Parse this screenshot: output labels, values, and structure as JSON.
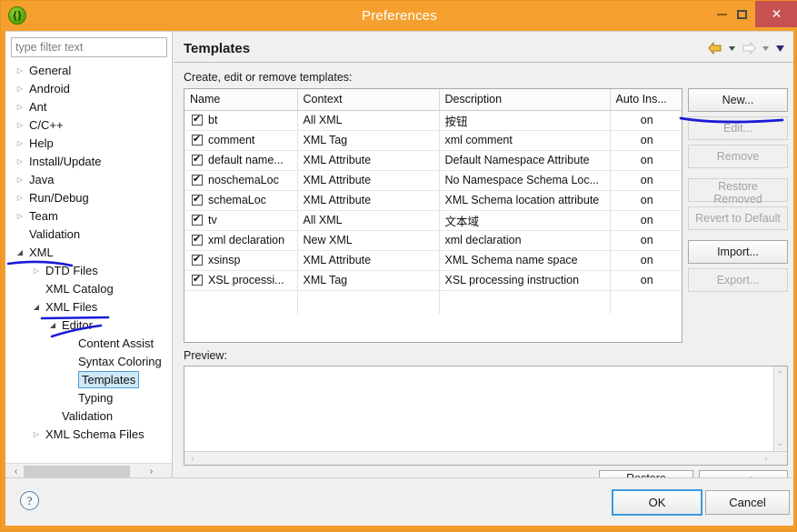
{
  "window": {
    "title": "Preferences",
    "icon": "braces-icon",
    "accent_color": "#f5a02e",
    "close_color": "#c75050",
    "controls": {
      "minimize": "minimize-icon",
      "maximize": "maximize-icon",
      "close": "close-icon"
    }
  },
  "sidebar": {
    "filter_placeholder": "type filter text",
    "filter_value": "",
    "scroll": {
      "left_arrow": "‹",
      "right_arrow": "›"
    },
    "items": [
      {
        "label": "General",
        "indent": 0,
        "arrow": "collapsed",
        "selected": false
      },
      {
        "label": "Android",
        "indent": 0,
        "arrow": "collapsed",
        "selected": false
      },
      {
        "label": "Ant",
        "indent": 0,
        "arrow": "collapsed",
        "selected": false
      },
      {
        "label": "C/C++",
        "indent": 0,
        "arrow": "collapsed",
        "selected": false
      },
      {
        "label": "Help",
        "indent": 0,
        "arrow": "collapsed",
        "selected": false
      },
      {
        "label": "Install/Update",
        "indent": 0,
        "arrow": "collapsed",
        "selected": false
      },
      {
        "label": "Java",
        "indent": 0,
        "arrow": "collapsed",
        "selected": false
      },
      {
        "label": "Run/Debug",
        "indent": 0,
        "arrow": "collapsed",
        "selected": false
      },
      {
        "label": "Team",
        "indent": 0,
        "arrow": "collapsed",
        "selected": false
      },
      {
        "label": "Validation",
        "indent": 0,
        "arrow": "none",
        "selected": false
      },
      {
        "label": "XML",
        "indent": 0,
        "arrow": "expanded",
        "selected": false
      },
      {
        "label": "DTD Files",
        "indent": 1,
        "arrow": "collapsed",
        "selected": false
      },
      {
        "label": "XML Catalog",
        "indent": 1,
        "arrow": "none",
        "selected": false
      },
      {
        "label": "XML Files",
        "indent": 1,
        "arrow": "expanded",
        "selected": false
      },
      {
        "label": "Editor",
        "indent": 2,
        "arrow": "expanded",
        "selected": false
      },
      {
        "label": "Content Assist",
        "indent": 3,
        "arrow": "none",
        "selected": false
      },
      {
        "label": "Syntax Coloring",
        "indent": 3,
        "arrow": "none",
        "selected": false
      },
      {
        "label": "Templates",
        "indent": 3,
        "arrow": "none",
        "selected": true
      },
      {
        "label": "Typing",
        "indent": 3,
        "arrow": "none",
        "selected": false
      },
      {
        "label": "Validation",
        "indent": 2,
        "arrow": "none",
        "selected": false
      },
      {
        "label": "XML Schema Files",
        "indent": 1,
        "arrow": "collapsed",
        "selected": false
      }
    ]
  },
  "content": {
    "page_title": "Templates",
    "section_label": "Create, edit or remove templates:",
    "nav": {
      "back_icon": "back-arrow-icon",
      "back_menu_icon": "chevron-down-icon",
      "forward_icon": "forward-arrow-icon",
      "forward_menu_icon": "chevron-down-icon",
      "more_icon": "chevron-down-icon",
      "back_color": "#e8a020",
      "forward_color": "#d3d3d3",
      "more_color": "#3a3a7a"
    },
    "table": {
      "headers": [
        "Name",
        "Context",
        "Description",
        "Auto Ins..."
      ],
      "rows": [
        {
          "checked": true,
          "name": "bt",
          "context": "All XML",
          "description": "按钮",
          "auto_insert": "on"
        },
        {
          "checked": true,
          "name": "comment",
          "context": "XML Tag",
          "description": "xml comment",
          "auto_insert": "on"
        },
        {
          "checked": true,
          "name": "default name...",
          "context": "XML Attribute",
          "description": "Default Namespace Attribute",
          "auto_insert": "on"
        },
        {
          "checked": true,
          "name": "noschemaLoc",
          "context": "XML Attribute",
          "description": "No Namespace Schema Loc...",
          "auto_insert": "on"
        },
        {
          "checked": true,
          "name": "schemaLoc",
          "context": "XML Attribute",
          "description": "XML Schema location attribute",
          "auto_insert": "on"
        },
        {
          "checked": true,
          "name": "tv",
          "context": "All XML",
          "description": "文本域",
          "auto_insert": "on"
        },
        {
          "checked": true,
          "name": "xml declaration",
          "context": "New XML",
          "description": "xml declaration",
          "auto_insert": "on"
        },
        {
          "checked": true,
          "name": "xsinsp",
          "context": "XML Attribute",
          "description": "XML Schema name space",
          "auto_insert": "on"
        },
        {
          "checked": true,
          "name": "XSL processi...",
          "context": "XML Tag",
          "description": "XSL processing instruction",
          "auto_insert": "on"
        }
      ]
    },
    "side_buttons": [
      {
        "label": "New...",
        "enabled": true
      },
      {
        "label": "Edit...",
        "enabled": false
      },
      {
        "label": "Remove",
        "enabled": false
      },
      {
        "label": "Restore Removed",
        "enabled": false
      },
      {
        "label": "Revert to Default",
        "enabled": false
      },
      {
        "label": "Import...",
        "enabled": true
      },
      {
        "label": "Export...",
        "enabled": false
      }
    ],
    "preview": {
      "label": "Preview:",
      "text": "",
      "scroll_up": "⌃",
      "scroll_down": "⌄",
      "scroll_left": "‹",
      "scroll_right": "›"
    },
    "restore_defaults_label": "Restore Defaults",
    "apply_label": "Apply"
  },
  "footer": {
    "help_icon": "help-icon",
    "ok_label": "OK",
    "cancel_label": "Cancel"
  },
  "annotations": {
    "color": "#1a1ad6",
    "note": "hand-drawn blue underlines highlighting XML, XML Files, Editor and the Edit... button"
  }
}
